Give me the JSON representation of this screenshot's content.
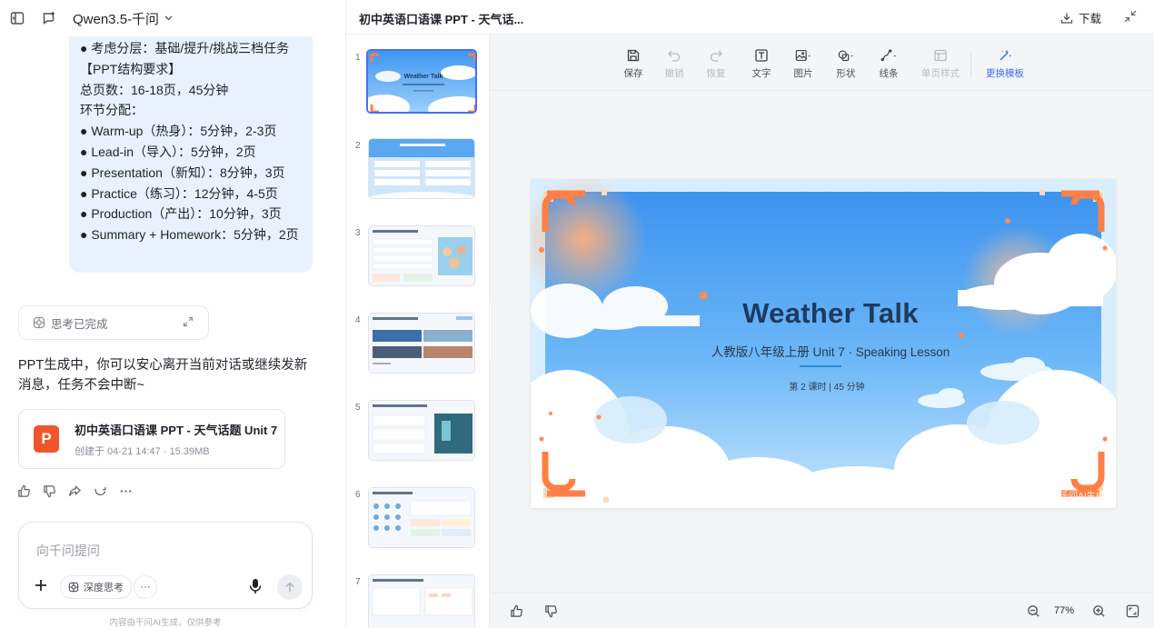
{
  "header": {
    "model_name": "Qwen3.5-千问"
  },
  "assistant_message": {
    "lines": [
      "● 考虑分层：基础/提升/挑战三档任务",
      "【PPT结构要求】",
      "总页数：16-18页，45分钟",
      "环节分配：",
      "● Warm-up（热身）：5分钟，2-3页",
      "● Lead-in（导入）：5分钟，2页",
      "● Presentation（新知）：8分钟，3页",
      "● Practice（练习）：12分钟，4-5页",
      "● Production（产出）：10分钟，3页",
      "● Summary + Homework：5分钟，2页"
    ]
  },
  "thinking": {
    "label": "思考已完成"
  },
  "status_text": "PPT生成中，你可以安心离开当前对话或继续发新消息，任务不会中断~",
  "file_card": {
    "icon_letter": "P",
    "title": "初中英语口语课 PPT - 天气话题 Unit 7",
    "meta": "创建于 04-21 14:47 · 15.39MB"
  },
  "input": {
    "placeholder": "向千问提问",
    "deep_think_label": "深度思考",
    "more_label": "···"
  },
  "disclaimer": "内容由千问AI生成，仅供参考",
  "editor": {
    "title": "初中英语口语课 PPT - 天气话...",
    "download_label": "下载",
    "toolbar": {
      "save": "保存",
      "undo": "撤销",
      "redo": "恢复",
      "text": "文字",
      "image": "图片",
      "shape": "形状",
      "line": "线条",
      "page_style": "单页样式",
      "change_template": "更换模板"
    },
    "thumbnails": [
      "1",
      "2",
      "3",
      "4",
      "5",
      "6",
      "7"
    ],
    "slide": {
      "title": "Weather Talk",
      "subtitle": "人教版八年级上册 Unit 7 · Speaking Lesson",
      "meta": "第 2 课时 | 45 分钟",
      "watermark": "✿ 千问AI生成"
    },
    "zoom": "77%"
  },
  "colors": {
    "bubble_bg": "#e8f1fd",
    "accent_blue": "#3b6cf6",
    "ppt_orange": "#f0552c",
    "slide_sky": "#4aa3f5",
    "slide_title": "#1e3a5f",
    "corner_orange": "#ff7f45"
  }
}
